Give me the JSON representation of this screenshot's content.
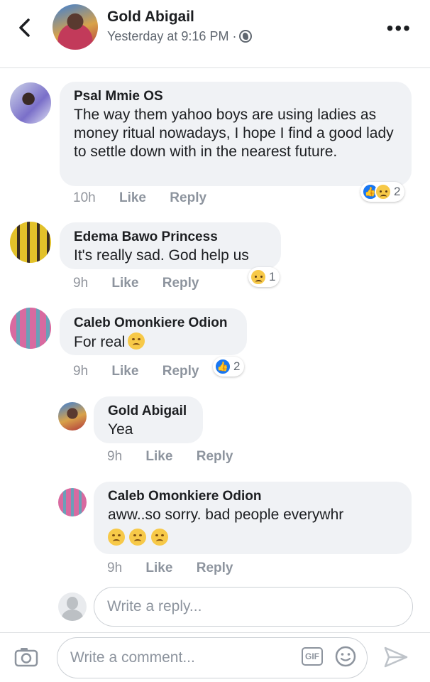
{
  "header": {
    "author": "Gold Abigail",
    "timestamp": "Yesterday at 9:16 PM ·"
  },
  "comments": [
    {
      "name": "Psal Mmie OS",
      "text": "The way them yahoo boys are using ladies as money ritual nowadays, I hope I find a good lady to settle down with in the nearest future.",
      "time": "10h",
      "like_label": "Like",
      "reply_label": "Reply",
      "reactions": [
        "like",
        "sad"
      ],
      "reaction_count": "2"
    },
    {
      "name": "Edema Bawo Princess",
      "text": "It's really sad. God help us",
      "time": "9h",
      "like_label": "Like",
      "reply_label": "Reply",
      "reactions": [
        "sad"
      ],
      "reaction_count": "1"
    },
    {
      "name": "Caleb Omonkiere Odion",
      "text": "For real",
      "time": "9h",
      "like_label": "Like",
      "reply_label": "Reply",
      "reactions": [
        "like"
      ],
      "reaction_count": "2"
    }
  ],
  "replies": [
    {
      "name": "Gold Abigail",
      "text": "Yea",
      "time": "9h",
      "like_label": "Like",
      "reply_label": "Reply"
    },
    {
      "name": "Caleb Omonkiere Odion",
      "text": "aww..so sorry. bad people everywhr",
      "time": "9h",
      "like_label": "Like",
      "reply_label": "Reply"
    }
  ],
  "reply_input": {
    "placeholder": "Write a reply..."
  },
  "comment_input": {
    "placeholder": "Write a comment..."
  },
  "composer": {
    "gif_label": "GIF"
  },
  "colors": {
    "like_blue": "#1877f2",
    "bubble_gray": "#f0f2f5",
    "meta_gray": "#8d949e"
  }
}
